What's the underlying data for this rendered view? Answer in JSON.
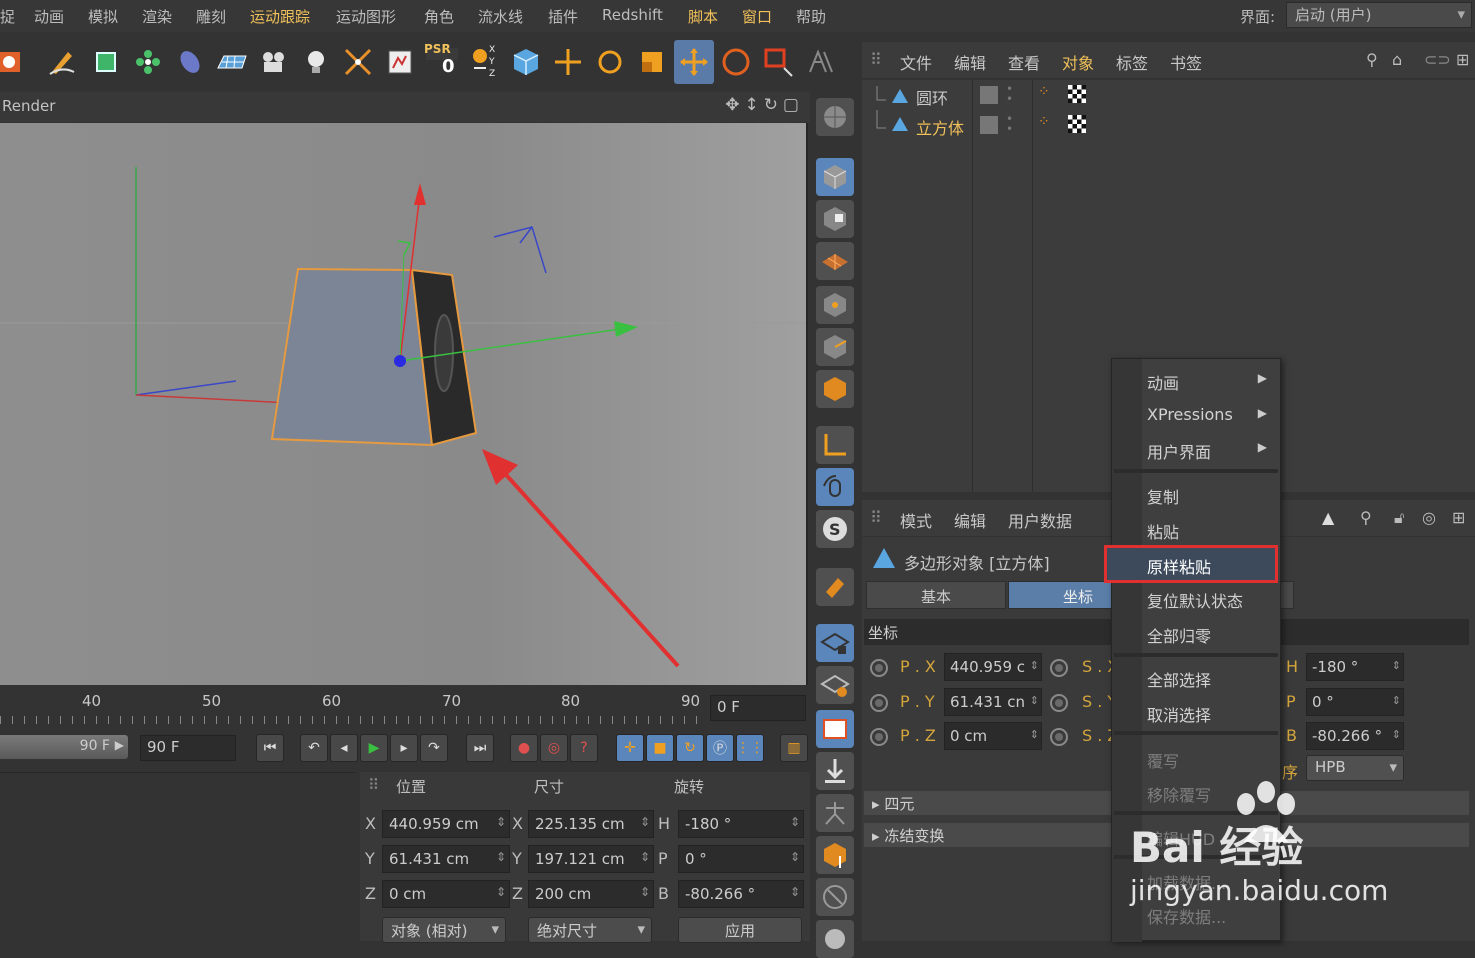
{
  "menubar": {
    "items": [
      "捉",
      "动画",
      "模拟",
      "渲染",
      "雕刻",
      "运动跟踪",
      "运动图形",
      "角色",
      "流水线",
      "插件",
      "Redshift",
      "脚本",
      "窗口",
      "帮助"
    ],
    "highlighted": [
      "运动跟踪",
      "脚本",
      "窗口"
    ],
    "layout_label": "界面:",
    "layout_value": "启动 (用户)"
  },
  "toolbar": {
    "icons": [
      "render-settings-icon",
      "pen-spline-icon",
      "cube-generator-icon",
      "cloner-icon",
      "deformer-icon",
      "floor-icon",
      "camera-icon",
      "light-bulb-icon",
      "effector-icon",
      "script-icon",
      "psr-icon",
      "axis-xyz-icon",
      "primitive-cube-icon",
      "move-icon",
      "rotate-icon",
      "scale-icon",
      "move-active-icon",
      "live-select-icon",
      "rect-select-icon",
      "lasso-icon"
    ],
    "psr_label": "PSR",
    "psr_value": "0",
    "axis_label": "X Y Z"
  },
  "viewport": {
    "title": "Render"
  },
  "timeline": {
    "ticks": [
      "40",
      "50",
      "60",
      "70",
      "80",
      "90"
    ],
    "current_frame": "0 F",
    "range_end": "90 F",
    "end_frame": "90 F"
  },
  "coord_manager": {
    "headers": {
      "position": "位置",
      "size": "尺寸",
      "rotation": "旋转"
    },
    "rows": [
      {
        "pos_axis": "X",
        "pos": "440.959 cm",
        "size_axis": "X",
        "size": "225.135 cm",
        "rot_axis": "H",
        "rot": "-180 °"
      },
      {
        "pos_axis": "Y",
        "pos": "61.431 cm",
        "size_axis": "Y",
        "size": "197.121 cm",
        "rot_axis": "P",
        "rot": "0 °"
      },
      {
        "pos_axis": "Z",
        "pos": "0 cm",
        "size_axis": "Z",
        "size": "200 cm",
        "rot_axis": "B",
        "rot": "-80.266 °"
      }
    ],
    "mode_dropdown": "对象 (相对)",
    "size_dropdown": "绝对尺寸",
    "apply_button": "应用"
  },
  "object_manager": {
    "menu": [
      "文件",
      "编辑",
      "查看",
      "对象",
      "标签",
      "书签"
    ],
    "highlighted": "对象",
    "objects": [
      {
        "name": "圆环",
        "selected": false
      },
      {
        "name": "立方体",
        "selected": true
      }
    ]
  },
  "attribute_manager": {
    "menu": [
      "模式",
      "编辑",
      "用户数据"
    ],
    "title": "多边形对象 [立方体]",
    "tabs": [
      "基本",
      "坐标"
    ],
    "active_tab": "坐标",
    "section": "坐标",
    "p_rows": [
      {
        "label": "P . X",
        "value": "440.959 c"
      },
      {
        "label": "P . Y",
        "value": "61.431 cn"
      },
      {
        "label": "P . Z",
        "value": "0 cm"
      }
    ],
    "s_labels": [
      "S . X",
      "S . Y",
      "S . Z"
    ],
    "r_rows": [
      {
        "label": "H",
        "value": "-180 °"
      },
      {
        "label": "P",
        "value": "0 °"
      },
      {
        "label": "B",
        "value": "-80.266 °"
      }
    ],
    "order_label": "序",
    "order_value": "HPB",
    "groups": [
      "四元",
      "冻结变换"
    ]
  },
  "context_menu": {
    "items": [
      {
        "label": "动画",
        "submenu": true,
        "disabled": false
      },
      {
        "label": "XPressions",
        "submenu": true,
        "disabled": false
      },
      {
        "label": "用户界面",
        "submenu": true,
        "disabled": false
      },
      {
        "label": "复制",
        "submenu": false,
        "disabled": false
      },
      {
        "label": "粘贴",
        "submenu": false,
        "disabled": false
      },
      {
        "label": "原样粘贴",
        "submenu": false,
        "disabled": false
      },
      {
        "label": "复位默认状态",
        "submenu": false,
        "disabled": false
      },
      {
        "label": "全部归零",
        "submenu": false,
        "disabled": false
      },
      {
        "label": "全部选择",
        "submenu": false,
        "disabled": false
      },
      {
        "label": "取消选择",
        "submenu": false,
        "disabled": false
      },
      {
        "label": "覆写",
        "submenu": false,
        "disabled": true
      },
      {
        "label": "移除覆写",
        "submenu": false,
        "disabled": true
      },
      {
        "label": "编辑HUD",
        "submenu": false,
        "disabled": true
      },
      {
        "label": "加载数据...",
        "submenu": false,
        "disabled": true
      },
      {
        "label": "保存数据...",
        "submenu": false,
        "disabled": true
      }
    ],
    "highlighted": "原样粘贴",
    "highlight_color": "#e03030"
  },
  "watermark": {
    "brand": "Bai 经验",
    "url": "jingyan.baidu.com"
  },
  "colors": {
    "accent_blue": "#5b86bb",
    "highlight_orange": "#f0c05a",
    "annotation_red": "#e03030"
  }
}
